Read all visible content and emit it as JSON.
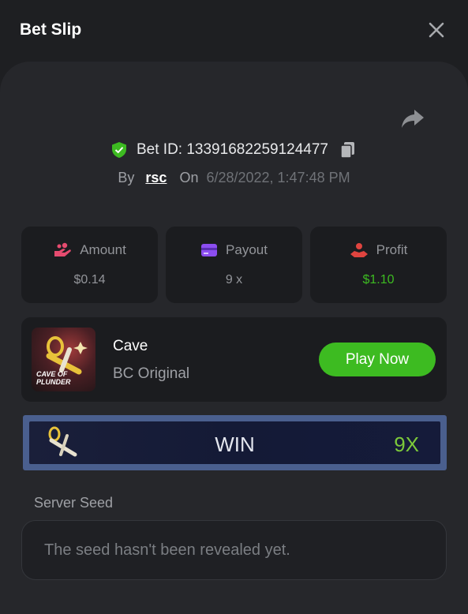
{
  "header": {
    "title": "Bet Slip"
  },
  "bet": {
    "id_label": "Bet ID: 13391682259124477",
    "by_label": "By",
    "user": "rsc",
    "on_label": "On",
    "date": "6/28/2022, 1:47:48 PM"
  },
  "stats": [
    {
      "label": "Amount",
      "value": "$0.14",
      "icon": "amount-icon",
      "value_color": "#93959a"
    },
    {
      "label": "Payout",
      "value": "9 x",
      "icon": "payout-icon",
      "value_color": "#93959a"
    },
    {
      "label": "Profit",
      "value": "$1.10",
      "icon": "profit-icon",
      "value_color": "#3dbb21"
    }
  ],
  "game": {
    "name": "Cave",
    "category": "BC Original",
    "thumbnail_caption": "CAVE OF PLUNDER",
    "play_label": "Play Now"
  },
  "result": {
    "label": "WIN",
    "multiplier": "9X"
  },
  "server_seed": {
    "label": "Server Seed",
    "value": "The seed hasn't been revealed yet."
  },
  "colors": {
    "accent_green": "#3dbb21",
    "panel": "#26272b",
    "card": "#1b1c1f"
  }
}
